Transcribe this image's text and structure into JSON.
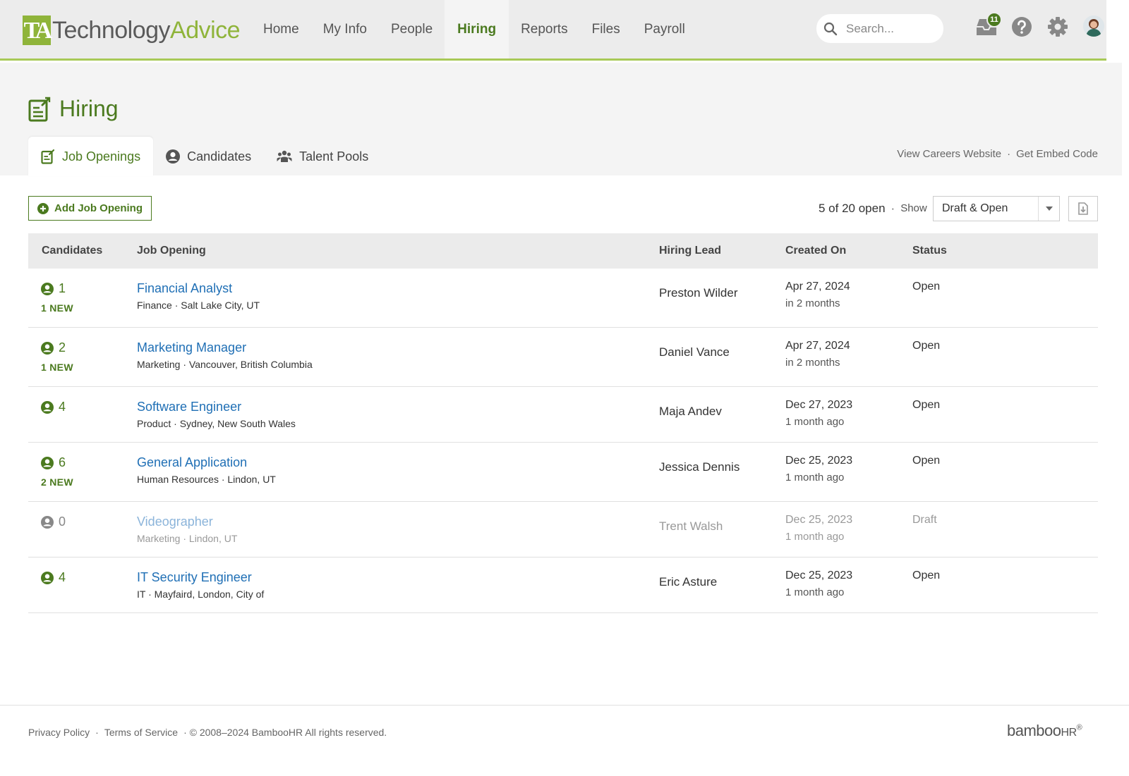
{
  "header": {
    "logo_ta": "TA",
    "logo_tech": "Technology",
    "logo_advice": "Advice",
    "nav": [
      {
        "label": "Home"
      },
      {
        "label": "My Info"
      },
      {
        "label": "People"
      },
      {
        "label": "Hiring",
        "active": true
      },
      {
        "label": "Reports"
      },
      {
        "label": "Files"
      },
      {
        "label": "Payroll"
      }
    ],
    "search_placeholder": "Search...",
    "inbox_count": "11"
  },
  "page": {
    "title": "Hiring",
    "tabs": [
      {
        "label": "Job Openings",
        "active": true
      },
      {
        "label": "Candidates"
      },
      {
        "label": "Talent Pools"
      }
    ],
    "link_careers": "View Careers Website",
    "link_separator": "·",
    "link_embed": "Get Embed Code"
  },
  "toolbar": {
    "add_label": "Add Job Opening",
    "count": "5 of 20 open",
    "dot": "·",
    "show": "Show",
    "filter_value": "Draft & Open"
  },
  "table": {
    "headers": {
      "candidates": "Candidates",
      "job": "Job Opening",
      "lead": "Hiring Lead",
      "created": "Created On",
      "status": "Status"
    },
    "rows": [
      {
        "count": "1",
        "new": "1 NEW",
        "job": "Financial Analyst",
        "sub": "Finance · Salt Lake City, UT",
        "lead": "Preston Wilder",
        "date": "Apr 27, 2024",
        "rel": "in 2 months",
        "status": "Open"
      },
      {
        "count": "2",
        "new": "1 NEW",
        "job": "Marketing Manager",
        "sub": "Marketing · Vancouver, British Columbia",
        "lead": "Daniel Vance",
        "date": "Apr 27, 2024",
        "rel": "in 2 months",
        "status": "Open"
      },
      {
        "count": "4",
        "new": "",
        "job": "Software Engineer",
        "sub": "Product · Sydney, New South Wales",
        "lead": "Maja Andev",
        "date": "Dec 27, 2023",
        "rel": "1 month ago",
        "status": "Open"
      },
      {
        "count": "6",
        "new": "2 NEW",
        "job": "General Application",
        "sub": "Human Resources · Lindon, UT",
        "lead": "Jessica Dennis",
        "date": "Dec 25, 2023",
        "rel": "1 month ago",
        "status": "Open"
      },
      {
        "count": "0",
        "new": "",
        "job": "Videographer",
        "sub": "Marketing · Lindon, UT",
        "lead": "Trent Walsh",
        "date": "Dec 25, 2023",
        "rel": "1 month ago",
        "status": "Draft"
      },
      {
        "count": "4",
        "new": "",
        "job": "IT Security Engineer",
        "sub": "IT · Mayfaird, London, City of",
        "lead": "Eric Asture",
        "date": "Dec 25, 2023",
        "rel": "1 month ago",
        "status": "Open"
      }
    ]
  },
  "footer": {
    "privacy": "Privacy Policy",
    "sep": "·",
    "terms": "Terms of Service",
    "copyright": "· © 2008–2024 BambooHR All rights reserved.",
    "brand": "bamboo",
    "brand_hr": "HR",
    "brand_reg": "®"
  },
  "colors": {
    "brand_green": "#4b7a1f",
    "accent_lime": "#a8c957",
    "link_blue": "#1f6fb5"
  }
}
